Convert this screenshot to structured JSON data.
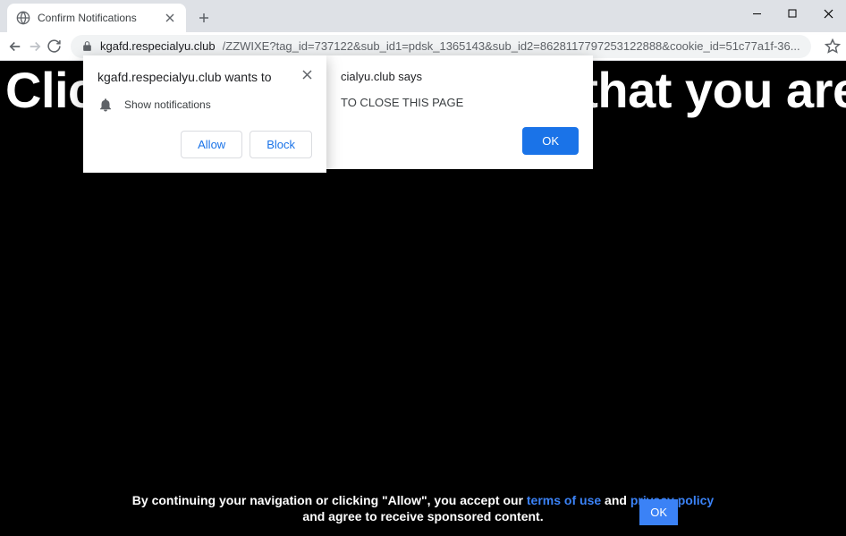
{
  "browser": {
    "tab_title": "Confirm Notifications",
    "url_domain": "kgafd.respecialyu.club",
    "url_path": "/ZZWIXE?tag_id=737122&sub_id1=pdsk_1365143&sub_id2=8628117797253122888&cookie_id=51c77a1f-36..."
  },
  "page": {
    "headline": "Click \"Allow\" to confirm that you are not"
  },
  "permission": {
    "origin_text": "kgafd.respecialyu.club wants to",
    "permission_label": "Show notifications",
    "allow_label": "Allow",
    "block_label": "Block"
  },
  "alert": {
    "title_suffix": "cialyu.club says",
    "message_suffix": "TO CLOSE THIS PAGE",
    "ok_label": "OK"
  },
  "cookie": {
    "text_before_links": "By continuing your navigation or clicking \"Allow\", you accept our ",
    "terms_link": "terms of use",
    "and_text": " and ",
    "privacy_link": "privacy policy",
    "line2": "and agree to receive sponsored content.",
    "ok_label": "OK"
  }
}
